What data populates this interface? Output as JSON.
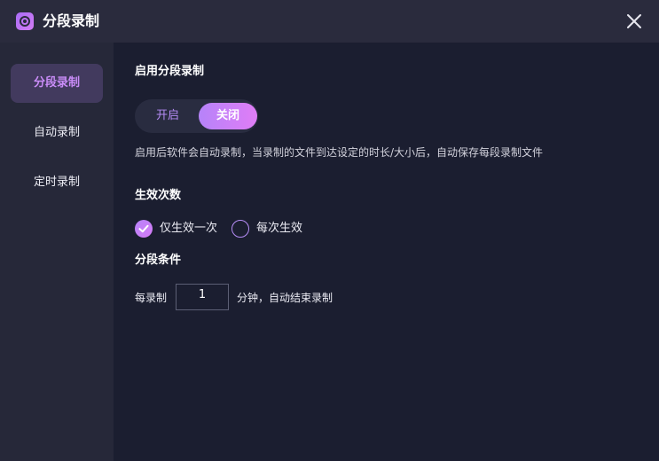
{
  "window": {
    "title": "分段录制",
    "close_icon": "close-icon",
    "accent_color": "#c98cf7",
    "gradient": [
      "#b683f9",
      "#e07df6"
    ]
  },
  "sidebar": {
    "items": [
      {
        "label": "分段录制",
        "active": true
      },
      {
        "label": "自动录制",
        "active": false
      },
      {
        "label": "定时录制",
        "active": false
      }
    ]
  },
  "main": {
    "enable_section": {
      "title": "启用分段录制",
      "toggle_on_label": "开启",
      "toggle_off_label": "关闭",
      "selected": "关闭",
      "description": "启用后软件会自动录制，当录制的文件到达设定的时长/大小后，自动保存每段录制文件"
    },
    "effect_section": {
      "title": "生效次数",
      "options": [
        {
          "label": "仅生效一次",
          "checked": true
        },
        {
          "label": "每次生效",
          "checked": false
        }
      ]
    },
    "condition_section": {
      "title": "分段条件",
      "prefix": "每录制",
      "minutes_value": "1",
      "suffix": "分钟，自动结束录制"
    }
  }
}
